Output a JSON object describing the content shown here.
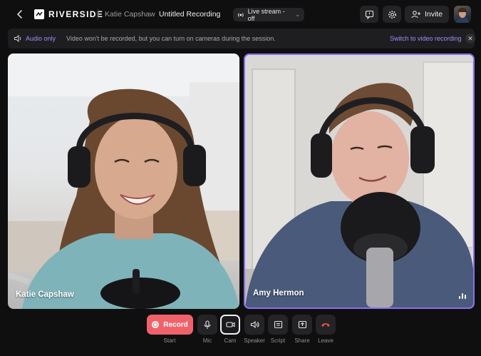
{
  "header": {
    "brand": "RIVERSIDE",
    "host_name": "Katie Capshaw",
    "recording_title": "Untitled Recording",
    "live_stream": "Live stream - off",
    "invite_label": "Invite"
  },
  "banner": {
    "mode": "Audio only",
    "message": "Video won't be recorded, but you can turn on cameras during the session.",
    "action": "Switch to video recording"
  },
  "participants": [
    {
      "name": "Katie Capshaw",
      "speaking": false
    },
    {
      "name": "Amy Hermon",
      "speaking": true
    }
  ],
  "controls": {
    "record_label": "Record",
    "start_label": "Start",
    "mic_label": "Mic",
    "cam_label": "Cam",
    "speaker_label": "Speaker",
    "script_label": "Script",
    "share_label": "Share",
    "leave_label": "Leave"
  },
  "colors": {
    "accent": "#a48bf7",
    "record": "#f0626a",
    "leave": "#e2514f",
    "background": "#0f0f10"
  }
}
